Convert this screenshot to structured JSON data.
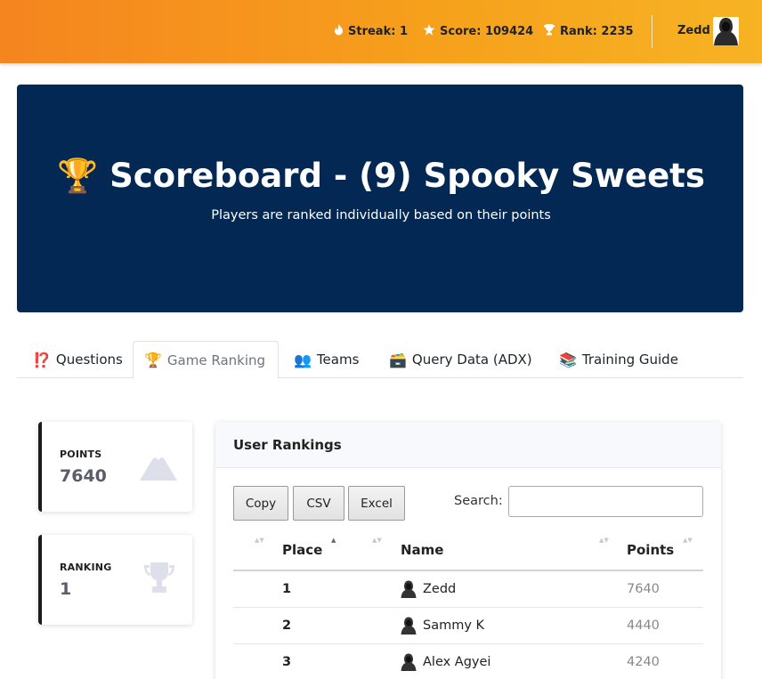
{
  "topbar": {
    "streak": "Streak: 1",
    "score": "Score: 109424",
    "rank": "Rank: 2235",
    "user": "Zedd"
  },
  "hero": {
    "title": "Scoreboard - (9) Spooky Sweets",
    "trophy": "🏆",
    "subtitle": "Players are ranked individually based on their points"
  },
  "tabs": [
    {
      "label": "Questions",
      "icon": "⁉️"
    },
    {
      "label": "Game Ranking",
      "icon": "🏆"
    },
    {
      "label": "Teams",
      "icon": "👥"
    },
    {
      "label": "Query Data (ADX)",
      "icon": "🗃️"
    },
    {
      "label": "Training Guide",
      "icon": "📚"
    }
  ],
  "stats": {
    "points_label": "POINTS",
    "points_value": "7640",
    "ranking_label": "RANKING",
    "ranking_value": "1"
  },
  "rankings": {
    "title": "User Rankings",
    "buttons": {
      "copy": "Copy",
      "csv": "CSV",
      "excel": "Excel"
    },
    "search_label": "Search:",
    "search_value": "",
    "columns": [
      "Place",
      "Name",
      "Points"
    ],
    "rows": [
      {
        "place": "1",
        "name": "Zedd",
        "points": "7640"
      },
      {
        "place": "2",
        "name": "Sammy K",
        "points": "4440"
      },
      {
        "place": "3",
        "name": "Alex Agyei",
        "points": "4240"
      }
    ]
  },
  "colors": {
    "topbar_start": "#f5851f",
    "topbar_end": "#f7b324",
    "hero_bg": "#032853"
  }
}
